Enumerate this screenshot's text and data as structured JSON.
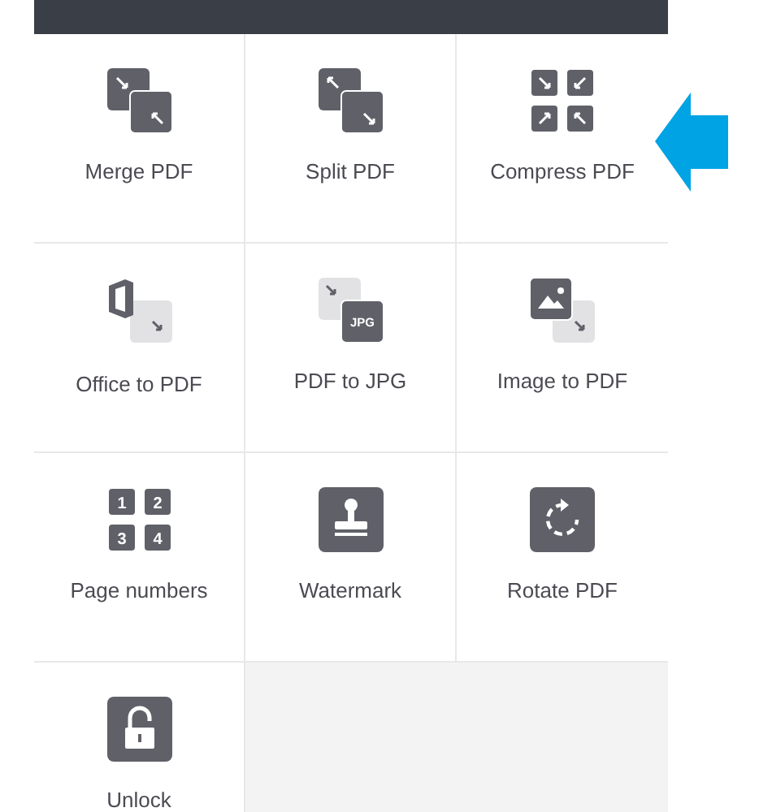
{
  "tools": [
    {
      "label": "Merge PDF",
      "kind": "merge"
    },
    {
      "label": "Split PDF",
      "kind": "split"
    },
    {
      "label": "Compress PDF",
      "kind": "compress"
    },
    {
      "label": "Office to PDF",
      "kind": "office"
    },
    {
      "label": "PDF to JPG",
      "kind": "jpg",
      "icon_label": "JPG"
    },
    {
      "label": "Image to PDF",
      "kind": "image"
    },
    {
      "label": "Page numbers",
      "kind": "numbers",
      "icon_labels": [
        "1",
        "2",
        "3",
        "4"
      ]
    },
    {
      "label": "Watermark",
      "kind": "watermark"
    },
    {
      "label": "Rotate PDF",
      "kind": "rotate"
    },
    {
      "label": "Unlock",
      "kind": "unlock"
    }
  ]
}
